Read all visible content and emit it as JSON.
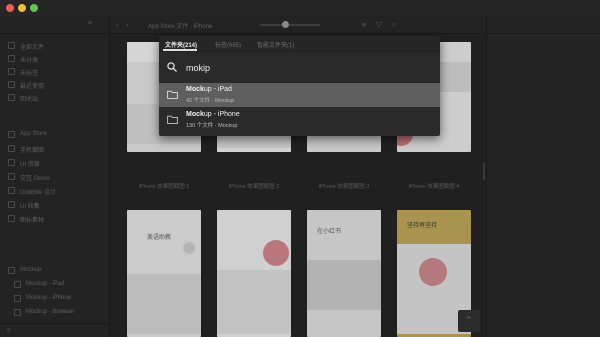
{
  "search": {
    "tabs": [
      "文件夹(214)",
      "标签(685)",
      "智能文件夹(1)"
    ],
    "query": "mokip",
    "results": [
      {
        "match": "Mock",
        "rest": "up - iPad",
        "count": "42 个文件",
        "sep": "·",
        "parent": "Mockup"
      },
      {
        "match": "Mock",
        "rest": "up - iPhone",
        "count": "130 个文件",
        "sep": "·",
        "parent": "Mockup"
      }
    ]
  },
  "toolbar": {
    "title": "App Store 文件 · iPhone"
  },
  "sidebar": {
    "items": [
      {
        "label": "全部文件",
        "count": ""
      },
      {
        "label": "未分类",
        "count": ""
      },
      {
        "label": "未标签",
        "count": ""
      },
      {
        "label": "最近使用",
        "count": ""
      },
      {
        "label": "回收站",
        "count": ""
      }
    ],
    "folders": [
      {
        "label": "App Store",
        "count": ""
      },
      {
        "label": "手机截图",
        "count": ""
      },
      {
        "label": "UI 资源",
        "count": ""
      },
      {
        "label": "交互 Demo",
        "count": ""
      },
      {
        "label": "Dribbble 设计",
        "count": ""
      },
      {
        "label": "UI 收集",
        "count": ""
      },
      {
        "label": "图标素材",
        "count": ""
      }
    ],
    "subfolders": [
      {
        "label": "Mockup"
      },
      {
        "label": "Mockup - iPad"
      },
      {
        "label": "Mockup - iPhone"
      },
      {
        "label": "Mockup - Browser"
      }
    ]
  },
  "cards": {
    "captions": [
      "iPhone 效果图截图 1",
      "iPhone 效果图截图 2",
      "iPhone 效果图截图 3",
      "iPhone 效果图截图 4"
    ],
    "row2_texts": [
      "美语助教",
      "在小红书",
      "坚持再坚持"
    ]
  },
  "colors": {
    "accent_red": "#e9717b",
    "accent_yellow": "#f3d25a",
    "overlay_selected": "#5e5e5e"
  },
  "icons": {
    "search": "search-icon",
    "folder": "folder-icon",
    "scroll_up": "arrow-up-icon"
  }
}
